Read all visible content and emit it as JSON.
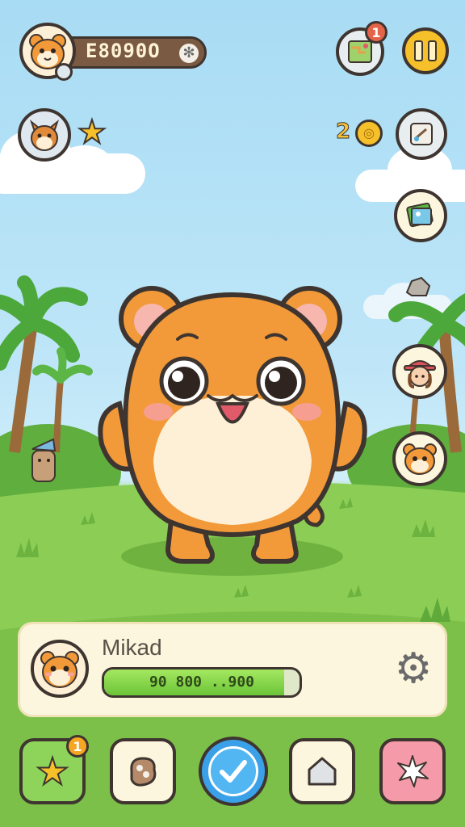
{
  "hud": {
    "coins_value": "E8090O",
    "notifications_badge": "1",
    "counter_value": "2",
    "coin_badge": "1"
  },
  "pet_panel": {
    "name": "Mikad",
    "progress_text": "90 800 ..900",
    "progress_fraction": 0.92
  },
  "colors": {
    "pet_orange": "#f29a3a",
    "pet_belly": "#fdf0d6",
    "outline": "#3f3530",
    "progress_green": "#7fd63a",
    "pause_yellow": "#f6c02a",
    "panel_cream": "#fdf6de"
  }
}
